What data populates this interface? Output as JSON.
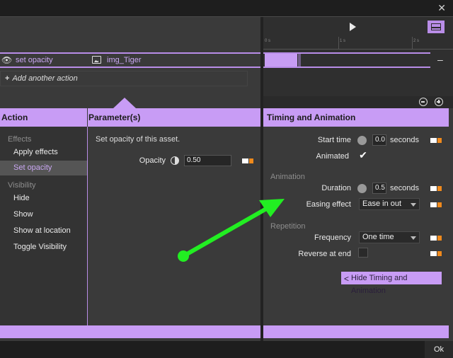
{
  "window": {
    "close_glyph": "✕"
  },
  "action_row": {
    "action_label": "set opacity",
    "asset_label": "img_Tiger",
    "add_action_label": "Add another action",
    "add_glyph": "+"
  },
  "timeline": {
    "ticks": [
      "0 s",
      "1 s",
      "2 s"
    ],
    "minus_glyph": "–",
    "bar_progress": 0.18
  },
  "left_panel": {
    "action_header": "Action",
    "parameters_header": "Parameter(s)",
    "groups": [
      {
        "label": "Effects",
        "items": [
          "Apply effects",
          "Set opacity"
        ]
      },
      {
        "label": "Visibility",
        "items": [
          "Hide",
          "Show",
          "Show at location",
          "Toggle Visibility"
        ]
      }
    ],
    "selected_item": "Set opacity",
    "description": "Set opacity of this asset.",
    "opacity_label": "Opacity",
    "opacity_value": "0.50"
  },
  "right_panel": {
    "header": "Timing and Animation",
    "start_time_label": "Start time",
    "start_time_value": "0.0",
    "start_time_unit": "seconds",
    "animated_label": "Animated",
    "animated_checked": "✔",
    "animation_section": "Animation",
    "duration_label": "Duration",
    "duration_value": "0.5",
    "duration_unit": "seconds",
    "easing_label": "Easing effect",
    "easing_value": "Ease in out",
    "repetition_section": "Repetition",
    "frequency_label": "Frequency",
    "frequency_value": "One time",
    "reverse_label": "Reverse at end",
    "hide_button": "Hide Timing and Animation"
  },
  "footer": {
    "ok_label": "Ok"
  },
  "colors": {
    "accent": "#c89cf5",
    "arrow": "#22ee22",
    "camera": "#f08a1c"
  }
}
